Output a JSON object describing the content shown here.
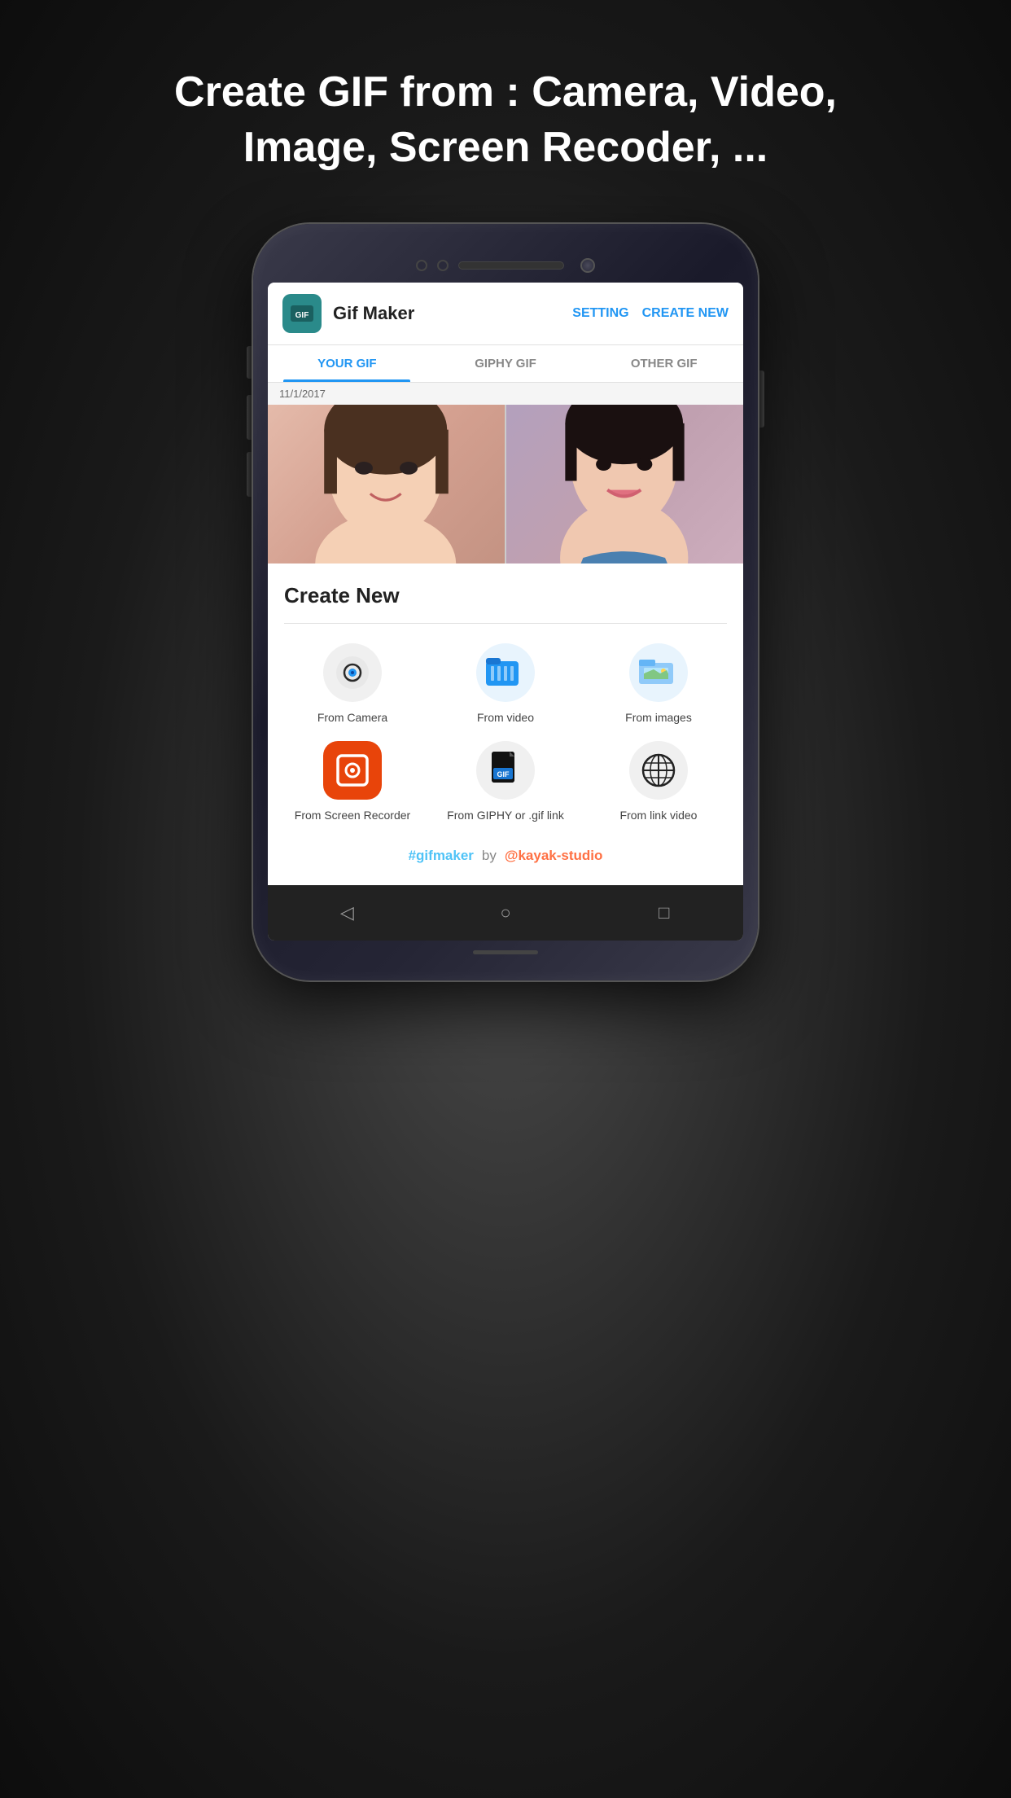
{
  "headline": {
    "prefix": "Create GIF from : ",
    "bold": "Camera, Video, Image, Screen Recoder, ..."
  },
  "appbar": {
    "title": "Gif Maker",
    "setting_label": "SETTING",
    "create_new_label": "CREATE NEW",
    "icon_text": "GIF"
  },
  "tabs": [
    {
      "label": "YOUR GIF",
      "active": true
    },
    {
      "label": "GIPHY GIF",
      "active": false
    },
    {
      "label": "OTHER GIF",
      "active": false
    }
  ],
  "date_label": "11/1/2017",
  "bottom_sheet": {
    "title": "Create New",
    "items": [
      {
        "id": "camera",
        "label": "From Camera",
        "icon_type": "camera"
      },
      {
        "id": "video",
        "label": "From video",
        "icon_type": "video"
      },
      {
        "id": "images",
        "label": "From images",
        "icon_type": "images"
      },
      {
        "id": "screen-recorder",
        "label": "From Screen Recorder",
        "icon_type": "screen"
      },
      {
        "id": "giphy",
        "label": "From GIPHY or .gif link",
        "icon_type": "giphy"
      },
      {
        "id": "link-video",
        "label": "From link video",
        "icon_type": "link"
      }
    ]
  },
  "footer": {
    "hashtag": "#gifmaker",
    "by": "by",
    "studio": "@kayak-studio"
  },
  "navbar": {
    "back_icon": "◁",
    "home_icon": "○",
    "recent_icon": "□"
  }
}
